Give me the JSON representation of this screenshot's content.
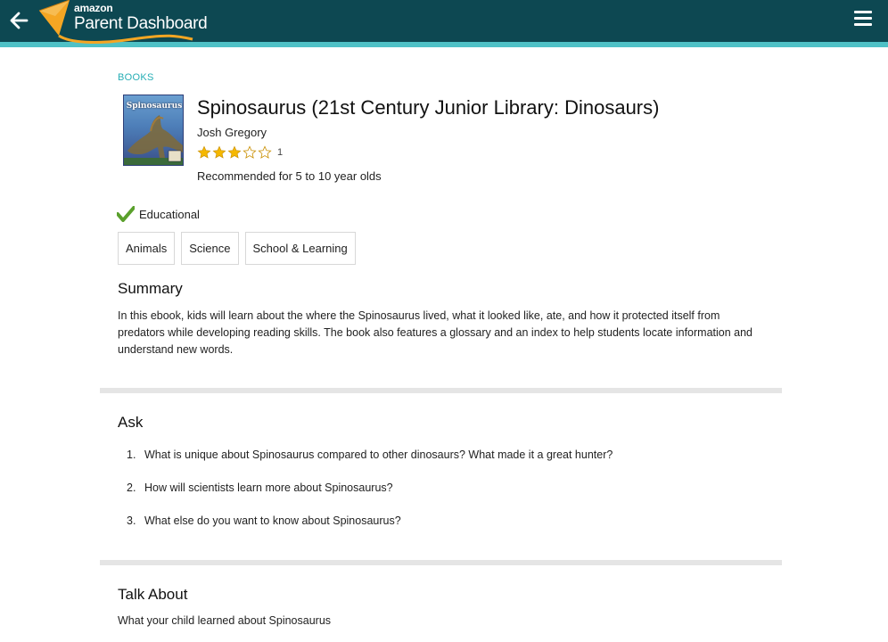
{
  "header": {
    "logo_small": "amazon",
    "logo_big": "Parent Dashboard",
    "colors": {
      "bar": "#0d4852",
      "accent": "#4fc1c6",
      "kite": "#f5a623"
    },
    "back_icon": "back-arrow-icon",
    "menu_icon": "hamburger-menu-icon"
  },
  "book": {
    "category": "BOOKS",
    "cover_text": "Spinosaurus",
    "title": "Spinosaurus (21st Century Junior Library: Dinosaurs)",
    "author": "Josh Gregory",
    "rating": 3,
    "rating_max": 5,
    "rating_count": "1",
    "age": "Recommended for 5 to 10 year olds"
  },
  "educational": {
    "label": "Educational",
    "icon": "checkmark-icon",
    "color": "#5aa02c"
  },
  "tags": [
    "Animals",
    "Science",
    "School & Learning"
  ],
  "summary": {
    "heading": "Summary",
    "text": "In this ebook, kids will learn about the where the Spinosaurus lived, what it looked like, ate, and how it protected itself from predators while developing reading skills. The book also features a glossary and an index to help students locate information and understand new words."
  },
  "ask": {
    "heading": "Ask",
    "items": [
      {
        "num": "1.",
        "text": "What is unique about Spinosaurus compared to other dinosaurs? What made it a great hunter?"
      },
      {
        "num": "2.",
        "text": "How will scientists learn more about Spinosaurus?"
      },
      {
        "num": "3.",
        "text": "What else do you want to know about Spinosaurus?"
      }
    ]
  },
  "talk": {
    "heading": "Talk About",
    "text": "What your child learned about Spinosaurus"
  }
}
